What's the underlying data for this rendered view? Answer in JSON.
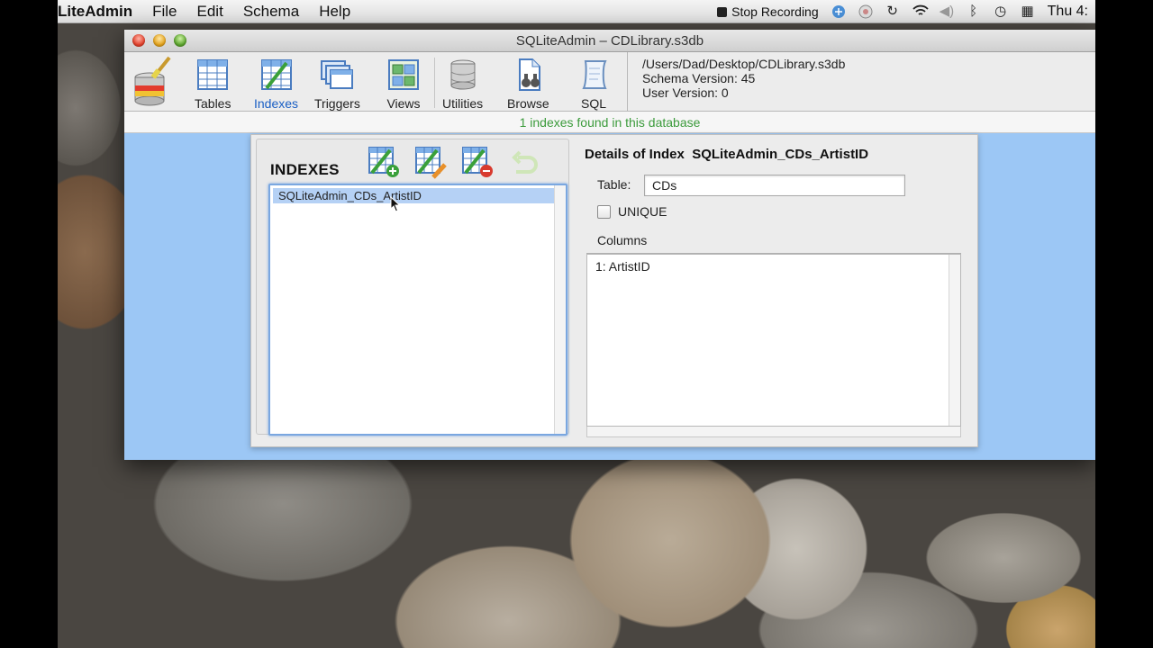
{
  "menubar": {
    "app_name": "LiteAdmin",
    "items": [
      "File",
      "Edit",
      "Schema",
      "Help"
    ],
    "stop_recording": "Stop Recording",
    "clock": "Thu 4:"
  },
  "window": {
    "title": "SQLiteAdmin – CDLibrary.s3db"
  },
  "toolbar": {
    "buttons": [
      {
        "label": "Tables",
        "icon": "table-icon"
      },
      {
        "label": "Indexes",
        "icon": "indexes-icon",
        "selected": true
      },
      {
        "label": "Triggers",
        "icon": "triggers-icon"
      },
      {
        "label": "Views",
        "icon": "views-icon"
      },
      {
        "label": "Utilities",
        "icon": "database-icon"
      },
      {
        "label": "Browse",
        "icon": "binoculars-icon"
      },
      {
        "label": "SQL",
        "icon": "scroll-icon"
      }
    ]
  },
  "dbinfo": {
    "path": "/Users/Dad/Desktop/CDLibrary.s3db",
    "schema_version": "Schema Version: 45",
    "user_version": "User Version: 0"
  },
  "status": "1 indexes found in this database",
  "indexes_panel": {
    "title": "INDEXES",
    "items": [
      "SQLiteAdmin_CDs_ArtistID"
    ]
  },
  "details": {
    "title": "Details of Index  SQLiteAdmin_CDs_ArtistID",
    "table_label": "Table:",
    "table_value": "CDs",
    "unique_label": "UNIQUE",
    "columns_label": "Columns",
    "columns": [
      "1: ArtistID"
    ]
  },
  "colors": {
    "accent": "#1a5fc4",
    "status_green": "#3c9b3c",
    "selection": "#b5d1f5",
    "window_bg": "#9cc7f5"
  }
}
